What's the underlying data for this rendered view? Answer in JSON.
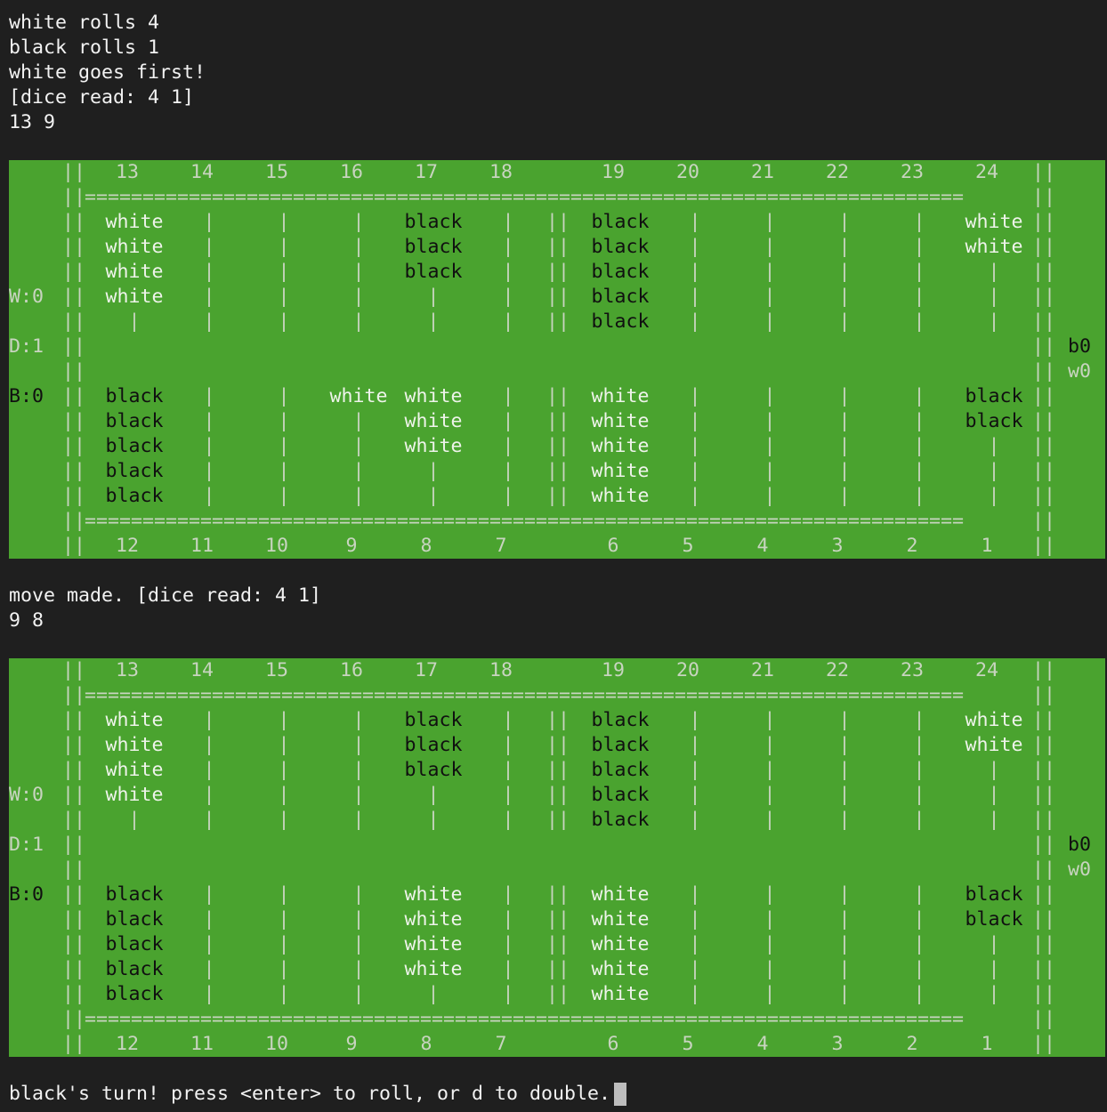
{
  "log1": [
    "white rolls 4",
    "black rolls 1",
    "white goes first!",
    "[dice read: 4 1]",
    "13 9"
  ],
  "log2": [
    "move made. [dice read: 4 1]",
    "9 8"
  ],
  "prompt": "black's turn! press <enter> to roll, or d to double.",
  "boards": [
    {
      "top_numbers": [
        "13",
        "14",
        "15",
        "16",
        "17",
        "18",
        "19",
        "20",
        "21",
        "22",
        "23",
        "24"
      ],
      "bottom_numbers": [
        "12",
        "11",
        "10",
        "9",
        "8",
        "7",
        "6",
        "5",
        "4",
        "3",
        "2",
        "1"
      ],
      "side_labels": {
        "w": "W:0",
        "d": "D:1",
        "b": "B:0"
      },
      "bar": {
        "b": "b0",
        "w": "w0"
      },
      "top": [
        [
          "white",
          "white",
          "white",
          "white",
          "|"
        ],
        [
          "|",
          "|",
          "|",
          "|",
          "|"
        ],
        [
          "|",
          "|",
          "|",
          "|",
          "|"
        ],
        [
          "|",
          "|",
          "|",
          "|",
          "|"
        ],
        [
          "black",
          "black",
          "black",
          "|",
          "|"
        ],
        [
          "|",
          "|",
          "|",
          "|",
          "|"
        ],
        [
          "black",
          "black",
          "black",
          "black",
          "black"
        ],
        [
          "|",
          "|",
          "|",
          "|",
          "|"
        ],
        [
          "|",
          "|",
          "|",
          "|",
          "|"
        ],
        [
          "|",
          "|",
          "|",
          "|",
          "|"
        ],
        [
          "|",
          "|",
          "|",
          "|",
          "|"
        ],
        [
          "white",
          "white",
          "|",
          "|",
          "|"
        ]
      ],
      "bottom": [
        [
          "black",
          "black",
          "black",
          "black",
          "black"
        ],
        [
          "|",
          "|",
          "|",
          "|",
          "|"
        ],
        [
          "|",
          "|",
          "|",
          "|",
          "|"
        ],
        [
          "|",
          "|",
          "|",
          "|",
          "white"
        ],
        [
          "|",
          "|",
          "white",
          "white",
          "white"
        ],
        [
          "|",
          "|",
          "|",
          "|",
          "|"
        ],
        [
          "white",
          "white",
          "white",
          "white",
          "white"
        ],
        [
          "|",
          "|",
          "|",
          "|",
          "|"
        ],
        [
          "|",
          "|",
          "|",
          "|",
          "|"
        ],
        [
          "|",
          "|",
          "|",
          "|",
          "|"
        ],
        [
          "|",
          "|",
          "|",
          "|",
          "|"
        ],
        [
          "|",
          "|",
          "|",
          "black",
          "black"
        ]
      ]
    },
    {
      "top_numbers": [
        "13",
        "14",
        "15",
        "16",
        "17",
        "18",
        "19",
        "20",
        "21",
        "22",
        "23",
        "24"
      ],
      "bottom_numbers": [
        "12",
        "11",
        "10",
        "9",
        "8",
        "7",
        "6",
        "5",
        "4",
        "3",
        "2",
        "1"
      ],
      "side_labels": {
        "w": "W:0",
        "d": "D:1",
        "b": "B:0"
      },
      "bar": {
        "b": "b0",
        "w": "w0"
      },
      "top": [
        [
          "white",
          "white",
          "white",
          "white",
          "|"
        ],
        [
          "|",
          "|",
          "|",
          "|",
          "|"
        ],
        [
          "|",
          "|",
          "|",
          "|",
          "|"
        ],
        [
          "|",
          "|",
          "|",
          "|",
          "|"
        ],
        [
          "black",
          "black",
          "black",
          "|",
          "|"
        ],
        [
          "|",
          "|",
          "|",
          "|",
          "|"
        ],
        [
          "black",
          "black",
          "black",
          "black",
          "black"
        ],
        [
          "|",
          "|",
          "|",
          "|",
          "|"
        ],
        [
          "|",
          "|",
          "|",
          "|",
          "|"
        ],
        [
          "|",
          "|",
          "|",
          "|",
          "|"
        ],
        [
          "|",
          "|",
          "|",
          "|",
          "|"
        ],
        [
          "white",
          "white",
          "|",
          "|",
          "|"
        ]
      ],
      "bottom": [
        [
          "black",
          "black",
          "black",
          "black",
          "black"
        ],
        [
          "|",
          "|",
          "|",
          "|",
          "|"
        ],
        [
          "|",
          "|",
          "|",
          "|",
          "|"
        ],
        [
          "|",
          "|",
          "|",
          "|",
          "|"
        ],
        [
          "|",
          "white",
          "white",
          "white",
          "white"
        ],
        [
          "|",
          "|",
          "|",
          "|",
          "|"
        ],
        [
          "white",
          "white",
          "white",
          "white",
          "white"
        ],
        [
          "|",
          "|",
          "|",
          "|",
          "|"
        ],
        [
          "|",
          "|",
          "|",
          "|",
          "|"
        ],
        [
          "|",
          "|",
          "|",
          "|",
          "|"
        ],
        [
          "|",
          "|",
          "|",
          "|",
          "|"
        ],
        [
          "|",
          "|",
          "|",
          "black",
          "black"
        ]
      ]
    }
  ],
  "colors": {
    "terminal_bg": "#1f1f1f",
    "board_bg": "#4aa32f",
    "text": "#f2f2f2"
  }
}
